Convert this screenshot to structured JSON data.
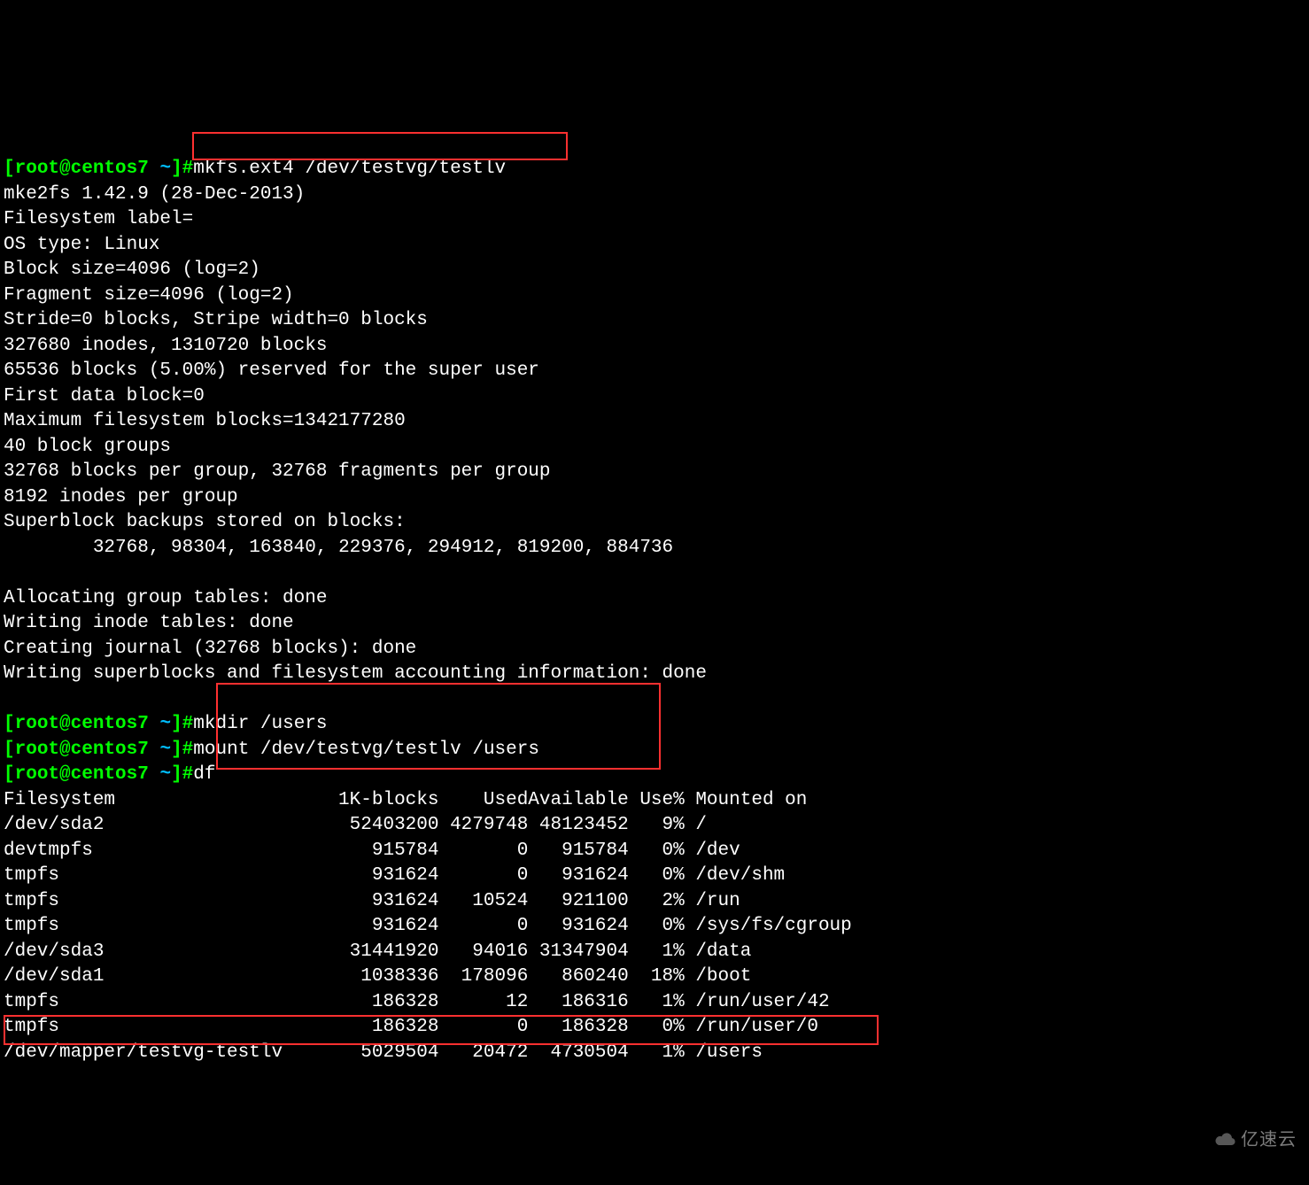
{
  "prompts": [
    {
      "user": "root",
      "host": "centos7",
      "dir": "~",
      "cmd": "mkfs.ext4 /dev/testvg/testlv"
    },
    {
      "user": "root",
      "host": "centos7",
      "dir": "~",
      "cmd": "mkdir /users"
    },
    {
      "user": "root",
      "host": "centos7",
      "dir": "~",
      "cmd": "mount /dev/testvg/testlv /users"
    },
    {
      "user": "root",
      "host": "centos7",
      "dir": "~",
      "cmd": "df"
    }
  ],
  "mkfs_output": [
    "mke2fs 1.42.9 (28-Dec-2013)",
    "Filesystem label=",
    "OS type: Linux",
    "Block size=4096 (log=2)",
    "Fragment size=4096 (log=2)",
    "Stride=0 blocks, Stripe width=0 blocks",
    "327680 inodes, 1310720 blocks",
    "65536 blocks (5.00%) reserved for the super user",
    "First data block=0",
    "Maximum filesystem blocks=1342177280",
    "40 block groups",
    "32768 blocks per group, 32768 fragments per group",
    "8192 inodes per group",
    "Superblock backups stored on blocks: ",
    "\t32768, 98304, 163840, 229376, 294912, 819200, 884736",
    "",
    "Allocating group tables: done                            ",
    "Writing inode tables: done                            ",
    "Creating journal (32768 blocks): done",
    "Writing superblocks and filesystem accounting information: done ",
    ""
  ],
  "df": {
    "header": [
      "Filesystem",
      "1K-blocks",
      "Used",
      "Available",
      "Use%",
      "Mounted on"
    ],
    "rows": [
      [
        "/dev/sda2",
        "52403200",
        "4279748",
        "48123452",
        "9%",
        "/"
      ],
      [
        "devtmpfs",
        "915784",
        "0",
        "915784",
        "0%",
        "/dev"
      ],
      [
        "tmpfs",
        "931624",
        "0",
        "931624",
        "0%",
        "/dev/shm"
      ],
      [
        "tmpfs",
        "931624",
        "10524",
        "921100",
        "2%",
        "/run"
      ],
      [
        "tmpfs",
        "931624",
        "0",
        "931624",
        "0%",
        "/sys/fs/cgroup"
      ],
      [
        "/dev/sda3",
        "31441920",
        "94016",
        "31347904",
        "1%",
        "/data"
      ],
      [
        "/dev/sda1",
        "1038336",
        "178096",
        "860240",
        "18%",
        "/boot"
      ],
      [
        "tmpfs",
        "186328",
        "12",
        "186316",
        "1%",
        "/run/user/42"
      ],
      [
        "tmpfs",
        "186328",
        "0",
        "186328",
        "0%",
        "/run/user/0"
      ],
      [
        "/dev/mapper/testvg-testlv",
        "5029504",
        "20472",
        "4730504",
        "1%",
        "/users"
      ]
    ]
  },
  "watermark": "亿速云"
}
